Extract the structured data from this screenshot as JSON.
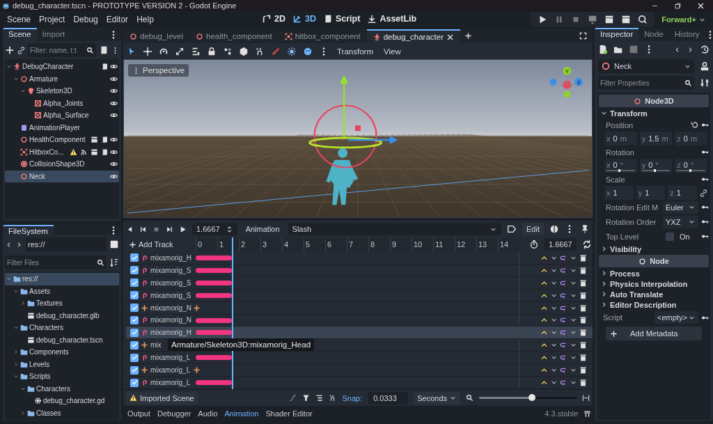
{
  "window": {
    "title": "debug_character.tscn - PROTOTYPE VERSION 2 - Godot Engine"
  },
  "menu": [
    "Scene",
    "Project",
    "Debug",
    "Editor",
    "Help"
  ],
  "workspaces": [
    {
      "label": "2D",
      "kind": "planar",
      "selected": false
    },
    {
      "label": "3D",
      "kind": "spatial",
      "selected": true
    },
    {
      "label": "Script",
      "kind": "script",
      "selected": false
    },
    {
      "label": "AssetLib",
      "kind": "assetlib",
      "selected": false
    }
  ],
  "run_bar": {
    "renderer": "Forward+"
  },
  "scene_dock": {
    "tabs": [
      {
        "label": "Scene",
        "selected": true
      },
      {
        "label": "Import",
        "selected": false
      }
    ],
    "filter": {
      "placeholder": "Filter: name, t:t"
    },
    "tree": [
      {
        "name": "DebugCharacter",
        "kind": "character",
        "expanded": true,
        "selected": false,
        "badges": [
          {
            "kind": "script"
          }
        ],
        "visible": true,
        "children": [
          {
            "name": "Armature",
            "kind": "node3d",
            "expanded": true,
            "selected": false,
            "visible": true,
            "children": [
              {
                "name": "Skeleton3D",
                "kind": "skeleton",
                "expanded": true,
                "selected": false,
                "visible": true,
                "children": [
                  {
                    "name": "Alpha_Joints",
                    "kind": "mesh",
                    "selected": false,
                    "visible": true
                  },
                  {
                    "name": "Alpha_Surface",
                    "kind": "mesh",
                    "selected": false,
                    "visible": true
                  }
                ]
              }
            ]
          },
          {
            "name": "AnimationPlayer",
            "kind": "animplayer",
            "selected": false
          },
          {
            "name": "HealthComponent",
            "kind": "node3d",
            "selected": false,
            "badges": [
              {
                "kind": "scene"
              },
              {
                "kind": "script"
              }
            ],
            "visible": true
          },
          {
            "name": "HitboxCo...",
            "kind": "area",
            "selected": false,
            "badges": [
              {
                "kind": "warning"
              },
              {
                "kind": "signal"
              },
              {
                "kind": "scene"
              },
              {
                "kind": "script"
              }
            ],
            "visible": true
          },
          {
            "name": "CollisionShape3D",
            "kind": "collision",
            "selected": false,
            "visible": true
          },
          {
            "name": "Neck",
            "kind": "node3d",
            "selected": true,
            "visible": true
          }
        ]
      }
    ]
  },
  "filesystem": {
    "tabs": [
      {
        "label": "FileSystem",
        "selected": true
      }
    ],
    "path": "res://",
    "filter": {
      "placeholder": "Filter Files"
    },
    "tree": [
      {
        "name": "res://",
        "kind": "folder",
        "expanded": true,
        "selected": true,
        "children": [
          {
            "name": "Assets",
            "kind": "folder",
            "expanded": true,
            "selected": false,
            "children": [
              {
                "name": "Textures",
                "kind": "folder",
                "expanded": false,
                "selected": false
              },
              {
                "name": "debug_character.glb",
                "kind": "scenefile",
                "selected": false
              }
            ]
          },
          {
            "name": "Characters",
            "kind": "folder",
            "expanded": true,
            "selected": false,
            "children": [
              {
                "name": "debug_character.tscn",
                "kind": "scenefile",
                "selected": false
              }
            ]
          },
          {
            "name": "Components",
            "kind": "folder",
            "expanded": false,
            "selected": false
          },
          {
            "name": "Levels",
            "kind": "folder",
            "expanded": false,
            "selected": false
          },
          {
            "name": "Scripts",
            "kind": "folder",
            "expanded": true,
            "selected": false,
            "children": [
              {
                "name": "Characters",
                "kind": "folder",
                "expanded": true,
                "selected": false,
                "children": [
                  {
                    "name": "debug_character.gd",
                    "kind": "scriptfile",
                    "selected": false
                  }
                ]
              },
              {
                "name": "Classes",
                "kind": "folder",
                "expanded": false,
                "selected": false
              }
            ]
          }
        ]
      }
    ]
  },
  "scene_tabs": [
    {
      "label": "debug_level",
      "kind": "node3d",
      "selected": false
    },
    {
      "label": "health_component",
      "kind": "node3d",
      "selected": false
    },
    {
      "label": "hitbox_component",
      "kind": "area",
      "selected": false
    },
    {
      "label": "debug_character",
      "kind": "character",
      "selected": true
    }
  ],
  "viewport": {
    "menus": [
      "Transform",
      "View"
    ],
    "view_button": "Perspective",
    "gizmo_labels": [
      "Y",
      "Z"
    ]
  },
  "animation": {
    "time": "1.6667",
    "menu": "Animation",
    "current": "Slash",
    "edit_button": "Edit",
    "add_track": "Add Track",
    "ruler": [
      "0",
      "1",
      "2",
      "3",
      "4",
      "5",
      "6",
      "7",
      "8",
      "9",
      "10",
      "11",
      "12",
      "13",
      "14"
    ],
    "length": "1.6667",
    "playhead": {
      "level": 0.111
    },
    "tracks": [
      {
        "name": "mixamorig_H",
        "kind": "rotation",
        "checked": true,
        "highlighted": false
      },
      {
        "name": "mixamorig_S",
        "kind": "rotation",
        "checked": true,
        "highlighted": false
      },
      {
        "name": "mixamorig_S",
        "kind": "rotation",
        "checked": true,
        "highlighted": false
      },
      {
        "name": "mixamorig_S",
        "kind": "rotation",
        "checked": true,
        "highlighted": false
      },
      {
        "name": "mixamorig_N",
        "kind": "position",
        "checked": true,
        "highlighted": false
      },
      {
        "name": "mixamorig_N",
        "kind": "rotation",
        "checked": true,
        "highlighted": false
      },
      {
        "name": "mixamorig_H",
        "kind": "rotation",
        "checked": true,
        "highlighted": true,
        "tooltip": "Armature/Skeleton3D:mixamorig_Head"
      },
      {
        "name": "mix",
        "kind": "position",
        "checked": true,
        "highlighted": false
      },
      {
        "name": "mixamorig_L",
        "kind": "rotation",
        "checked": true,
        "highlighted": false
      },
      {
        "name": "mixamorig_L",
        "kind": "position",
        "checked": true,
        "highlighted": false
      },
      {
        "name": "mixamorig_L",
        "kind": "rotation",
        "checked": true,
        "highlighted": false
      }
    ],
    "warning_button": "Imported Scene",
    "snap_label": "Snap:",
    "snap_value": "0.0333",
    "snap_unit": "Seconds",
    "zoom": {
      "level": 0.58
    }
  },
  "bottom_tabs": [
    {
      "label": "Output",
      "selected": false
    },
    {
      "label": "Debugger",
      "selected": false
    },
    {
      "label": "Audio",
      "selected": false
    },
    {
      "label": "Animation",
      "selected": true
    },
    {
      "label": "Shader Editor",
      "selected": false
    }
  ],
  "version": "4.3.stable",
  "inspector": {
    "tabs": [
      {
        "label": "Inspector",
        "selected": true
      },
      {
        "label": "Node",
        "selected": false
      },
      {
        "label": "History",
        "selected": false
      }
    ],
    "object": {
      "name": "Neck",
      "kind": "node3d"
    },
    "filter": {
      "placeholder": "Filter Properties"
    },
    "sections": [
      {
        "title": "Node3D",
        "kind": "node3d",
        "groups": [
          {
            "label": "Transform",
            "expanded": true,
            "properties": [
              {
                "kind": "vector",
                "label": "Position",
                "revert": true,
                "linked": false,
                "components": [
                  {
                    "axis": "x",
                    "value": "0",
                    "unit": "m"
                  },
                  {
                    "axis": "y",
                    "value": "1.5",
                    "unit": "m"
                  },
                  {
                    "axis": "z",
                    "value": "0",
                    "unit": "m"
                  }
                ]
              },
              {
                "kind": "vector",
                "label": "Rotation",
                "revert": false,
                "linked": false,
                "components": [
                  {
                    "axis": "x",
                    "value": "0",
                    "unit": "°",
                    "level": 0.5
                  },
                  {
                    "axis": "y",
                    "value": "0",
                    "unit": "°",
                    "level": 0.5
                  },
                  {
                    "axis": "z",
                    "value": "0",
                    "unit": "°",
                    "level": 0.5
                  }
                ]
              },
              {
                "kind": "vector",
                "label": "Scale",
                "revert": false,
                "linked": true,
                "components": [
                  {
                    "axis": "x",
                    "value": "1"
                  },
                  {
                    "axis": "y",
                    "value": "1"
                  },
                  {
                    "axis": "z",
                    "value": "1"
                  }
                ]
              },
              {
                "kind": "enum",
                "label": "Rotation Edit M",
                "value": "Euler"
              },
              {
                "kind": "enum",
                "label": "Rotation Order",
                "value": "YXZ"
              },
              {
                "kind": "checkbox",
                "label": "Top Level",
                "value": "On",
                "checked": false
              }
            ]
          },
          {
            "label": "Visibility",
            "expanded": false
          }
        ]
      },
      {
        "title": "Node",
        "kind": "node",
        "groups": [
          {
            "label": "Process",
            "expanded": false
          },
          {
            "label": "Physics Interpolation",
            "expanded": false
          },
          {
            "label": "Auto Translate",
            "expanded": false
          },
          {
            "label": "Editor Description",
            "expanded": false
          }
        ]
      }
    ],
    "script": {
      "label": "Script",
      "value": "<empty>"
    },
    "add_metadata": "Add Metadata"
  }
}
